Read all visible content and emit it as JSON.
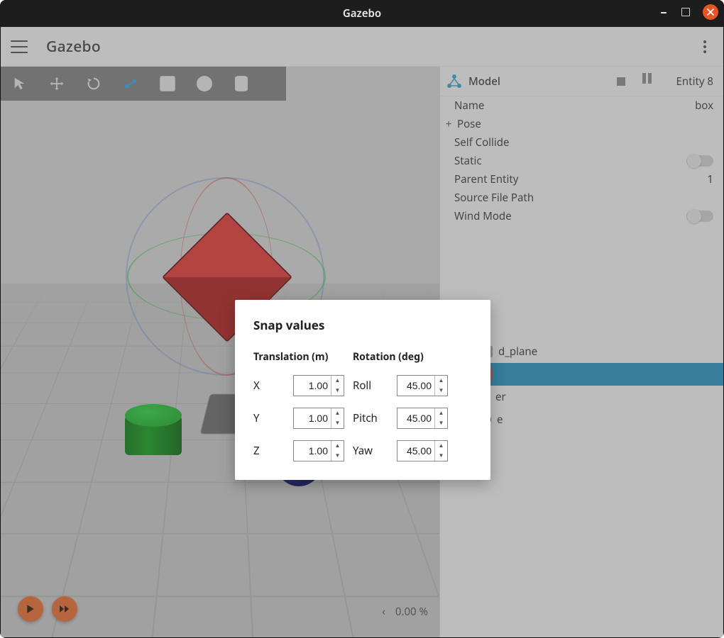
{
  "window": {
    "title": "Gazebo"
  },
  "appbar": {
    "title": "Gazebo"
  },
  "toolbar": {
    "icons": [
      "pointer-icon",
      "translate-icon",
      "rotate-icon",
      "link-icon",
      "box-prim-icon",
      "sphere-prim-icon",
      "cylinder-prim-icon"
    ]
  },
  "sidebar": {
    "header_label": "Model",
    "entity_label": "Entity 8",
    "props": {
      "name_label": "Name",
      "name_value": "box",
      "pose_label": "Pose",
      "self_collide_label": "Self Collide",
      "static_label": "Static",
      "parent_entity_label": "Parent Entity",
      "parent_entity_value": "1",
      "source_file_label": "Source File Path",
      "wind_mode_label": "Wind Mode"
    }
  },
  "tree": {
    "items": [
      {
        "label": "d_plane",
        "kind": "plane",
        "selected": false
      },
      {
        "label": "",
        "kind": "box",
        "selected": true
      },
      {
        "label": "er",
        "kind": "cyl",
        "selected": false
      },
      {
        "label": "e",
        "kind": "sph",
        "selected": false
      }
    ]
  },
  "playback": {
    "progress_pct": "0.00 %"
  },
  "dialog": {
    "title": "Snap values",
    "translation_header": "Translation (m)",
    "rotation_header": "Rotation (deg)",
    "rows": [
      {
        "t_label": "X",
        "t_value": "1.00",
        "r_label": "Roll",
        "r_value": "45.00"
      },
      {
        "t_label": "Y",
        "t_value": "1.00",
        "r_label": "Pitch",
        "r_value": "45.00"
      },
      {
        "t_label": "Z",
        "t_value": "1.00",
        "r_label": "Yaw",
        "r_value": "45.00"
      }
    ]
  }
}
